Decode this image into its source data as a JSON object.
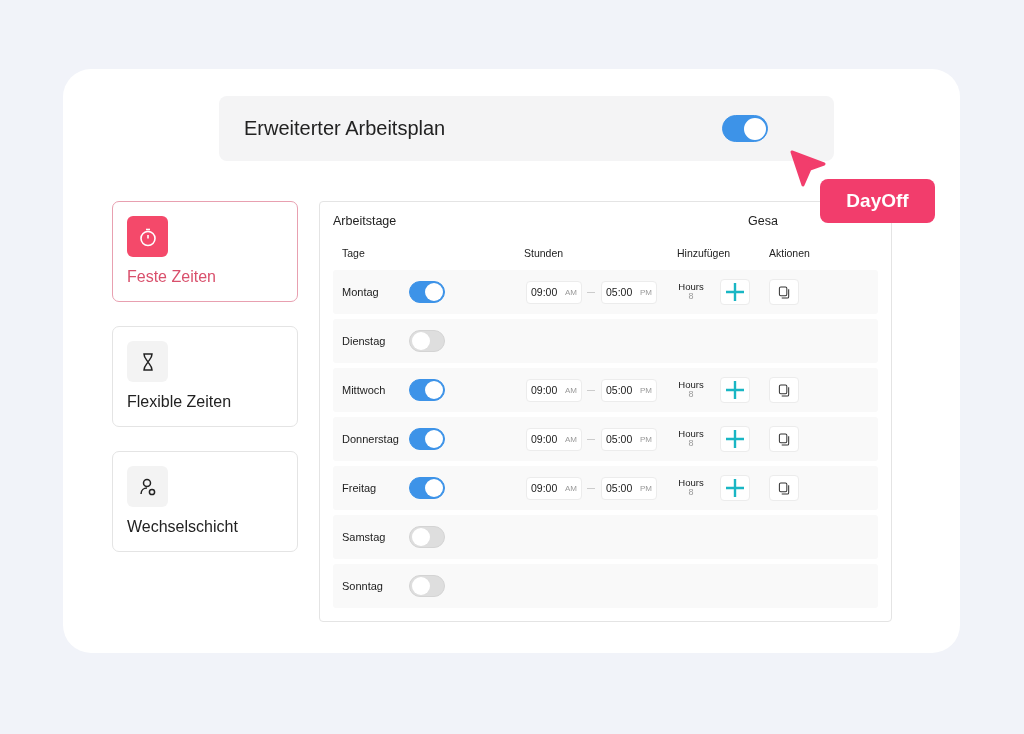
{
  "header": {
    "title": "Erweiterter Arbeitsplan",
    "on": true
  },
  "modes": [
    {
      "kind": "stopwatch",
      "label": "Feste Zeiten",
      "selected": true
    },
    {
      "kind": "hourglass",
      "label": "Flexible Zeiten",
      "selected": false
    },
    {
      "kind": "person",
      "label": "Wechselschicht",
      "selected": false
    }
  ],
  "table": {
    "title": "Arbeitstage",
    "total_label": "Gesa",
    "columns": [
      "Tage",
      "Stunden",
      "Hinzufügen",
      "Aktionen"
    ],
    "rows": [
      {
        "day": "Montag",
        "on": true,
        "start": "09:00",
        "start_period": "AM",
        "end": "05:00",
        "end_period": "PM",
        "hours_label": "Hours",
        "hours": "8"
      },
      {
        "day": "Dienstag",
        "on": false
      },
      {
        "day": "Mittwoch",
        "on": true,
        "start": "09:00",
        "start_period": "AM",
        "end": "05:00",
        "end_period": "PM",
        "hours_label": "Hours",
        "hours": "8"
      },
      {
        "day": "Donnerstag",
        "on": true,
        "start": "09:00",
        "start_period": "AM",
        "end": "05:00",
        "end_period": "PM",
        "hours_label": "Hours",
        "hours": "8"
      },
      {
        "day": "Freitag",
        "on": true,
        "start": "09:00",
        "start_period": "AM",
        "end": "05:00",
        "end_period": "PM",
        "hours_label": "Hours",
        "hours": "8"
      },
      {
        "day": "Samstag",
        "on": false
      },
      {
        "day": "Sonntag",
        "on": false
      }
    ]
  },
  "badge": "DayOff"
}
